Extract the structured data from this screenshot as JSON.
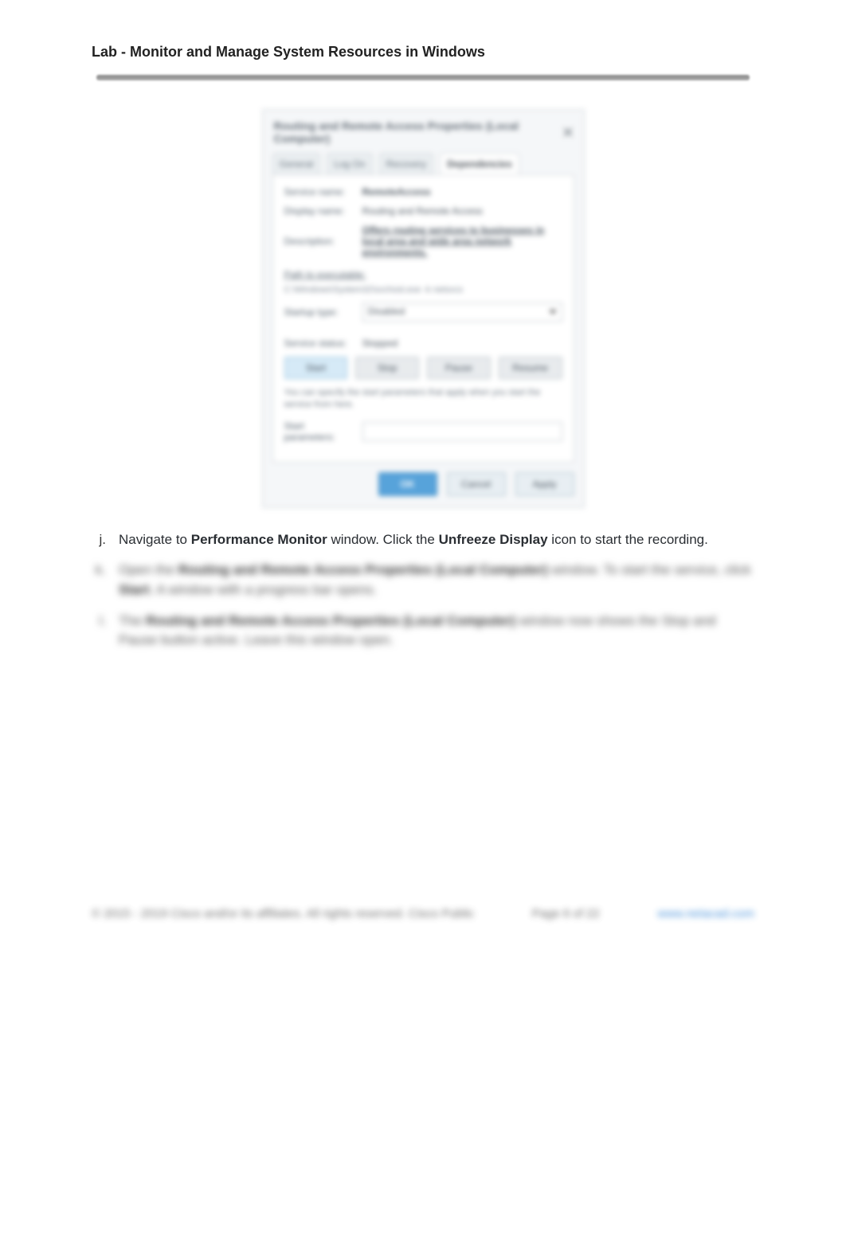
{
  "title": "Lab - Monitor and Manage System Resources in Windows",
  "dialog": {
    "title": "Routing and Remote Access Properties (Local Computer)",
    "tabs": [
      "General",
      "Log On",
      "Recovery",
      "Dependencies"
    ],
    "active_tab_index": 3,
    "service_name_label": "Service name:",
    "service_name_value": "RemoteAccess",
    "display_name_label": "Display name:",
    "display_name_value": "Routing and Remote Access",
    "description_label": "Description:",
    "description_value": "Offers routing services to businesses in local area and wide area network environments.",
    "path_label": "Path to executable:",
    "path_sub": "C:\\Windows\\System32\\svchost.exe -k netsvcs",
    "startup_label": "Startup type:",
    "startup_value": "Disabled",
    "status_label": "Service status:",
    "status_value": "Stopped",
    "btn_start": "Start",
    "btn_stop": "Stop",
    "btn_pause": "Pause",
    "btn_resume": "Resume",
    "note": "You can specify the start parameters that apply when you start the service from here.",
    "params_label": "Start parameters:",
    "footer_ok": "OK",
    "footer_cancel": "Cancel",
    "footer_apply": "Apply"
  },
  "steps": {
    "j": {
      "marker": "j.",
      "t1": "Navigate to ",
      "b1": "Performance Monitor",
      "t2": " window. Click the ",
      "b2": "Unfreeze Display",
      "t3": " icon to start the recording."
    },
    "k": {
      "marker": "k.",
      "t1": "Open the ",
      "b1": "Routing and Remote Access Properties (Local Computer)",
      "t2": " window. To start the service, click ",
      "b2": "Start",
      "t3": ". A window with a progress bar opens."
    },
    "l": {
      "marker": "l.",
      "t1": "The ",
      "b1": "Routing and Remote Access Properties (Local Computer)",
      "t2": " window now shows the Stop and Pause button active. Leave this window open."
    }
  },
  "footer": {
    "left": "© 2015 - 2019 Cisco and/or its affiliates. All rights reserved. Cisco Public",
    "center": "Page 6 of 22",
    "right": "www.netacad.com"
  }
}
